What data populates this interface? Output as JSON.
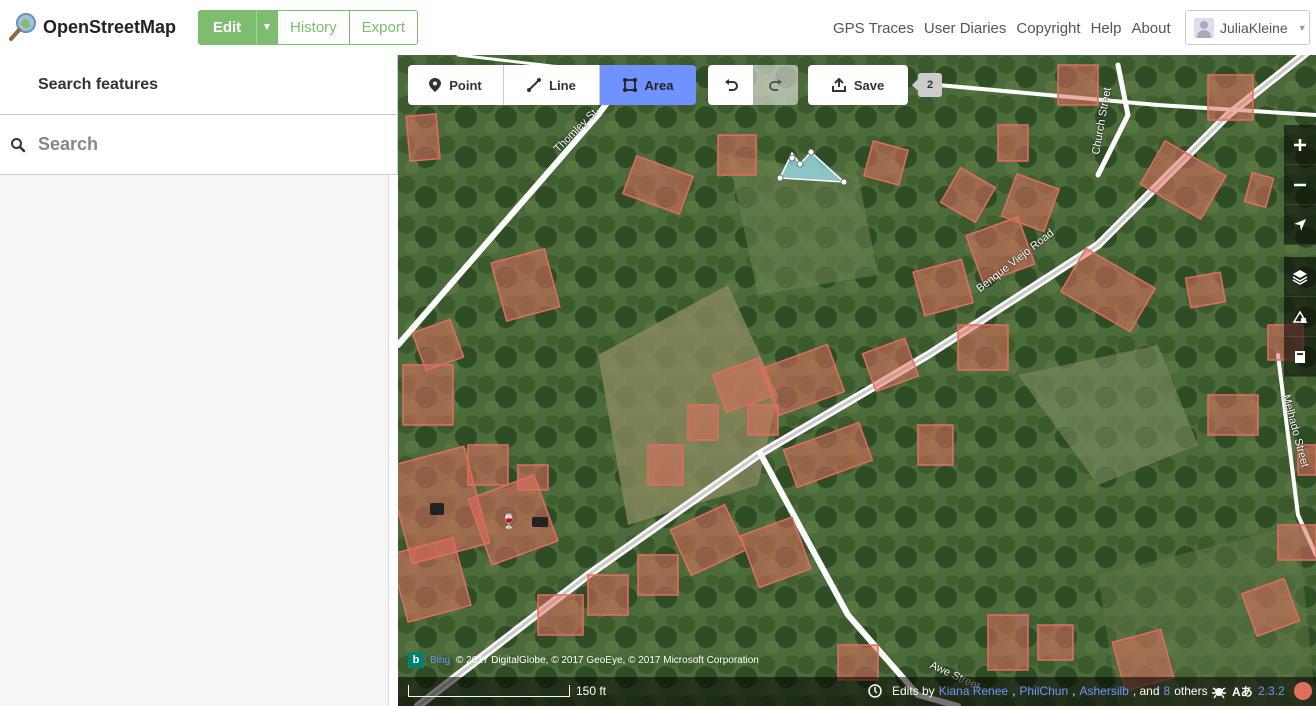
{
  "header": {
    "logo_text": "OpenStreetMap",
    "edit_label": "Edit",
    "history_label": "History",
    "export_label": "Export",
    "nav": [
      "GPS Traces",
      "User Diaries",
      "Copyright",
      "Help",
      "About"
    ],
    "user_name": "JuliaKleine"
  },
  "sidebar": {
    "title": "Search features",
    "search_placeholder": "Search"
  },
  "toolbar": {
    "modes": [
      "Point",
      "Line",
      "Area"
    ],
    "active_mode": "Area",
    "save_label": "Save",
    "save_count": "2"
  },
  "map": {
    "street_labels": [
      "Thomley St",
      "Church Street",
      "Benque Viejo Road",
      "Melhado Street",
      "Awe Street"
    ],
    "attribution": "© 2017 DigitalGlobe, © 2017 GeoEye, © 2017 Microsoft Corporation",
    "imagery_label": "Bing",
    "scale_label": "150 ft",
    "edits_prefix": "Edits by",
    "editors": [
      "Kiana Renee",
      "PhilChun",
      "Ashersilb"
    ],
    "edits_and": ", and",
    "others_count": "8",
    "others_label": "others",
    "version": "2.3.2"
  },
  "colors": {
    "osm_green": "#7ebc6f",
    "active_blue": "#7092ff",
    "building_fill": "#e06e5f"
  }
}
